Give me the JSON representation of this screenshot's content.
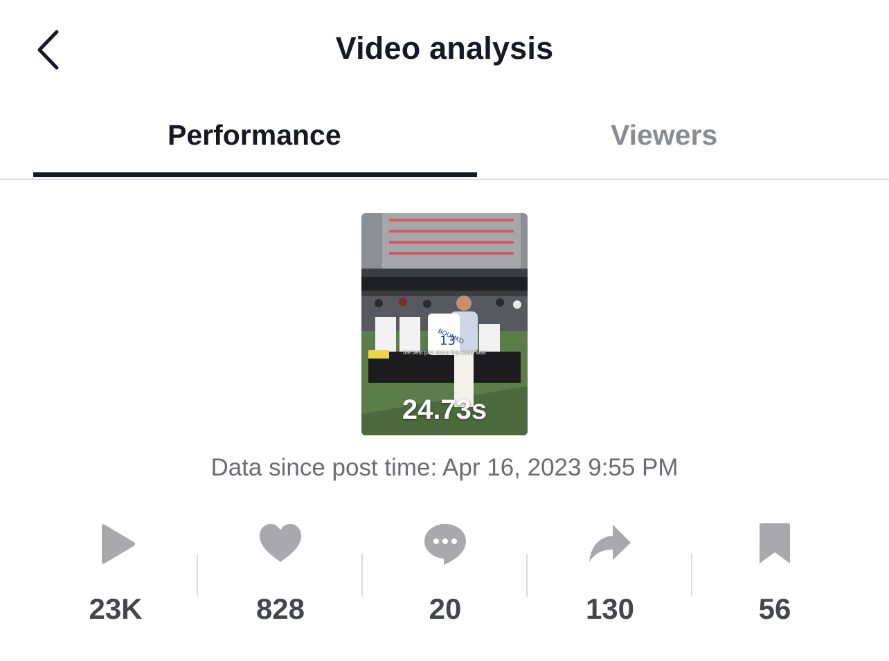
{
  "header": {
    "title": "Video analysis"
  },
  "tabs": [
    {
      "label": "Performance",
      "active": true
    },
    {
      "label": "Viewers",
      "active": false
    }
  ],
  "video": {
    "duration": "24.73s",
    "caption": "the best part about this event was"
  },
  "post_time": "Data since post time: Apr 16, 2023 9:55 PM",
  "stats": [
    {
      "icon": "play-icon",
      "value": "23K"
    },
    {
      "icon": "heart-icon",
      "value": "828"
    },
    {
      "icon": "comment-icon",
      "value": "20"
    },
    {
      "icon": "share-icon",
      "value": "130"
    },
    {
      "icon": "bookmark-icon",
      "value": "56"
    }
  ],
  "colors": {
    "text": "#161823",
    "muted": "#8a8b91",
    "icon_gray": "#a9a9ad",
    "stat_text": "#45464c"
  }
}
